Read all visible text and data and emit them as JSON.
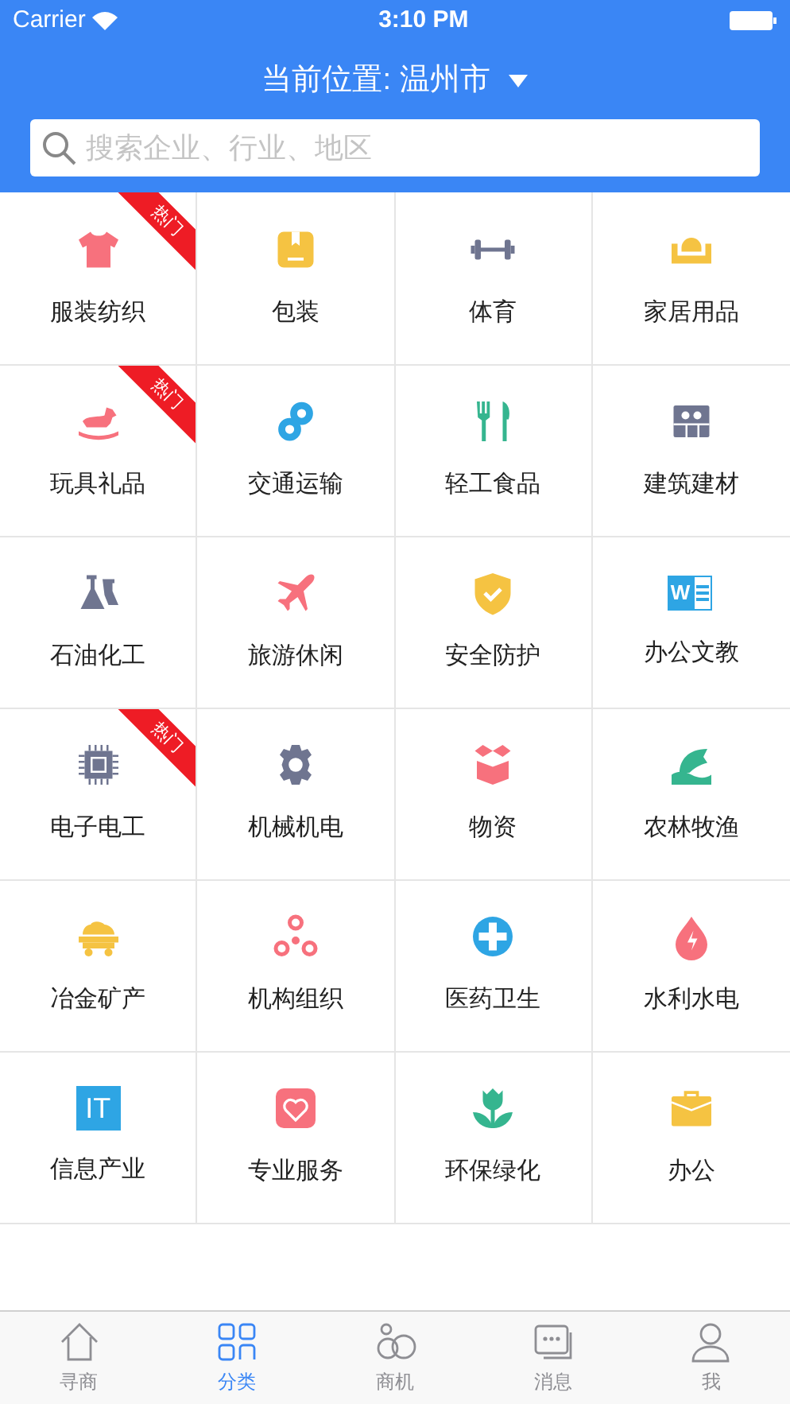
{
  "status_bar": {
    "carrier": "Carrier",
    "time": "3:10 PM"
  },
  "header": {
    "location_label": "当前位置: 温州市"
  },
  "search": {
    "placeholder": "搜索企业、行业、地区"
  },
  "categories": [
    {
      "label": "服装纺织",
      "hot": true,
      "hot_label": "热门"
    },
    {
      "label": "包装",
      "hot": false
    },
    {
      "label": "体育",
      "hot": false
    },
    {
      "label": "家居用品",
      "hot": false
    },
    {
      "label": "玩具礼品",
      "hot": true,
      "hot_label": "热门"
    },
    {
      "label": "交通运输",
      "hot": false
    },
    {
      "label": "轻工食品",
      "hot": false
    },
    {
      "label": "建筑建材",
      "hot": false
    },
    {
      "label": "石油化工",
      "hot": false
    },
    {
      "label": "旅游休闲",
      "hot": false
    },
    {
      "label": "安全防护",
      "hot": false
    },
    {
      "label": "办公文教",
      "hot": false,
      "icon_text": "W"
    },
    {
      "label": "电子电工",
      "hot": true,
      "hot_label": "热门"
    },
    {
      "label": "机械机电",
      "hot": false
    },
    {
      "label": "物资",
      "hot": false
    },
    {
      "label": "农林牧渔",
      "hot": false
    },
    {
      "label": "冶金矿产",
      "hot": false
    },
    {
      "label": "机构组织",
      "hot": false
    },
    {
      "label": "医药卫生",
      "hot": false
    },
    {
      "label": "水利水电",
      "hot": false
    },
    {
      "label": "信息产业",
      "hot": false,
      "icon_text": "IT"
    },
    {
      "label": "专业服务",
      "hot": false
    },
    {
      "label": "环保绿化",
      "hot": false
    },
    {
      "label": "办公",
      "hot": false
    }
  ],
  "tab_bar": [
    {
      "label": "寻商",
      "selected": false
    },
    {
      "label": "分类",
      "selected": true
    },
    {
      "label": "商机",
      "selected": false
    },
    {
      "label": "消息",
      "selected": false
    },
    {
      "label": "我",
      "selected": false
    }
  ]
}
